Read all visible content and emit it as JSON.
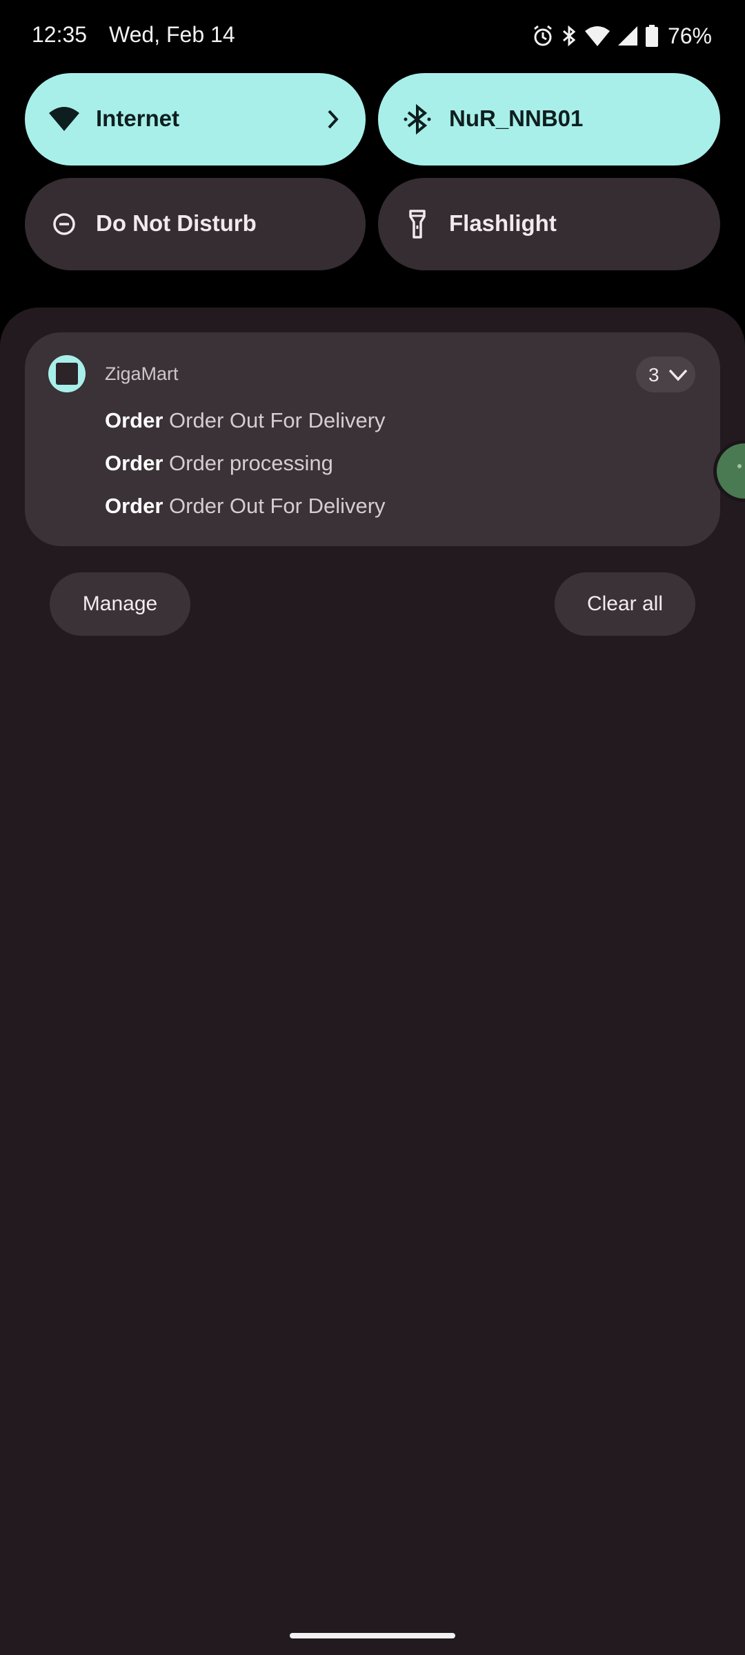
{
  "status_bar": {
    "time": "12:35",
    "date": "Wed, Feb 14",
    "battery": "76%",
    "icons": [
      "alarm-icon",
      "bluetooth-icon",
      "wifi-icon",
      "cell-signal-icon",
      "battery-icon"
    ]
  },
  "quick_settings": {
    "tiles": [
      {
        "label": "Internet",
        "icon": "wifi-icon",
        "active": true
      },
      {
        "label": "NuR_NNB01",
        "icon": "bluetooth-icon",
        "active": true
      },
      {
        "label": "Do Not Disturb",
        "icon": "dnd-icon",
        "active": false
      },
      {
        "label": "Flashlight",
        "icon": "flashlight-icon",
        "active": false
      }
    ]
  },
  "notification": {
    "app_name": "ZigaMart",
    "count": "3",
    "messages": [
      {
        "title": "Order",
        "text": "Order Out For Delivery"
      },
      {
        "title": "Order",
        "text": "Order processing"
      },
      {
        "title": "Order",
        "text": "Order Out For Delivery"
      }
    ]
  },
  "actions": {
    "manage": "Manage",
    "clear_all": "Clear all"
  },
  "colors": {
    "tile_active": "#a8efea",
    "tile_inactive": "#352d31",
    "shade_bg": "#221a1f",
    "card_bg": "#3a3236"
  }
}
